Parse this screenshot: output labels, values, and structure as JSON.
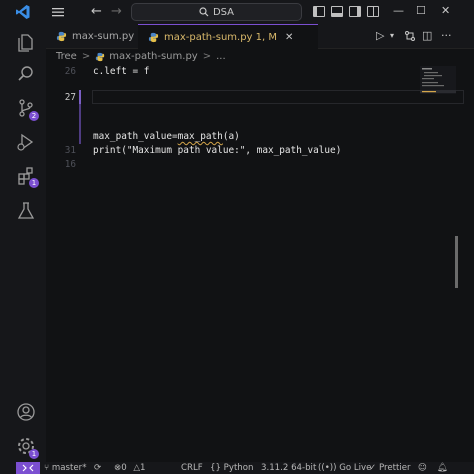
{
  "titlebar": {
    "search_text": "DSA",
    "back_glyph": "←",
    "forward_glyph": "→",
    "minimize_glyph": "—",
    "restore_glyph": "☐",
    "close_glyph": "✕",
    "icons": [
      "vscode-logo-icon",
      "menu-icon",
      "layout-sidebar-left-icon",
      "layout-panel-icon",
      "layout-sidebar-right-icon",
      "customize-layout-icon"
    ]
  },
  "activitybar": {
    "icons": [
      "explorer-icon",
      "search-icon",
      "source-control-icon",
      "run-debug-icon",
      "extensions-icon",
      "testing-icon",
      "account-icon",
      "manage-icon"
    ],
    "badges": {
      "source_control": "2",
      "extensions": "1",
      "manage": "1"
    },
    "accent": "#7b4fd1"
  },
  "tabs": [
    {
      "label": "max-sum.py",
      "active": false
    },
    {
      "label": "max-path-sum.py 1, M",
      "active": true,
      "close_glyph": "✕"
    }
  ],
  "tab_actions": {
    "run_glyph": "▷",
    "split_glyph": "◫",
    "more_glyph": "···"
  },
  "breadcrumb": {
    "items": [
      "Tree",
      "max-path-sum.py",
      "..."
    ],
    "separator": ">"
  },
  "editor": {
    "lines": [
      {
        "number": "26",
        "text": "c.left = f"
      },
      {
        "number": "27",
        "text": ""
      },
      {
        "number": "",
        "text": ""
      },
      {
        "number": "",
        "text": ""
      },
      {
        "number": "",
        "text": ""
      },
      {
        "number": "",
        "text": "max_path_value=max_path(a)"
      },
      {
        "number": "31",
        "text": "print(\"Maximum path value:\", max_path_value)"
      },
      {
        "number": "16",
        "text": ""
      }
    ],
    "line6_parts": [
      "max_path_value=",
      "max_path",
      "(a)"
    ],
    "warning_color": "#d4a64a"
  },
  "statusbar": {
    "branch": "master*",
    "sync_glyph": "⟳",
    "errors": "0",
    "warnings": "1",
    "eol": "CRLF",
    "language": "Python",
    "interpreter": "3.11.2 64-bit",
    "go_live": "Go Live",
    "prettier": "Prettier",
    "icons": [
      "remote-icon",
      "branch-icon",
      "sync-icon",
      "error-icon",
      "warning-icon",
      "braces-icon",
      "broadcast-icon",
      "check-icon",
      "bell-icon"
    ]
  }
}
